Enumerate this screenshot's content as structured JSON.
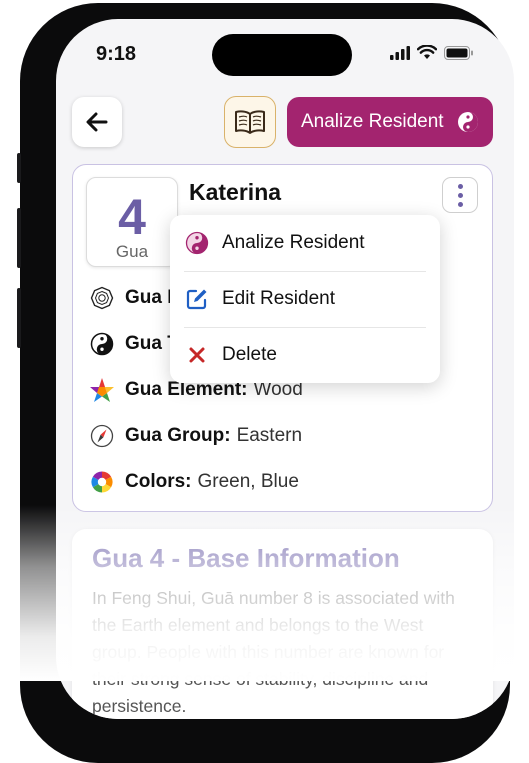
{
  "status_bar": {
    "time": "9:18"
  },
  "toolbar": {
    "analyze_label": "Analize Resident"
  },
  "resident": {
    "gua_number": "4",
    "gua_label": "Gua",
    "name": "Katerina"
  },
  "details": {
    "gua_number": {
      "label": "Gua N",
      "value": ""
    },
    "gua_type": {
      "label": "Gua T",
      "value": ""
    },
    "gua_element": {
      "label": "Gua Element:",
      "value": "Wood"
    },
    "gua_group": {
      "label": "Gua Group:",
      "value": "Eastern"
    },
    "colors": {
      "label": "Colors:",
      "value": "Green, Blue"
    }
  },
  "menu": {
    "items": [
      {
        "label": "Analize Resident",
        "icon": "yin-yang-icon"
      },
      {
        "label": "Edit Resident",
        "icon": "edit-icon"
      },
      {
        "label": "Delete",
        "icon": "close-icon"
      }
    ]
  },
  "base_info": {
    "title": "Gua 4 - Base Information",
    "body": "In Feng Shui, Guā number 8 is associated with the Earth element and belongs to the West group. People with this number are known for their strong sense of stability, discipline and persistence."
  },
  "colors": {
    "accent": "#a3246f",
    "primary": "#6b5ea5",
    "danger": "#c62828",
    "edit": "#1f5fc4"
  }
}
